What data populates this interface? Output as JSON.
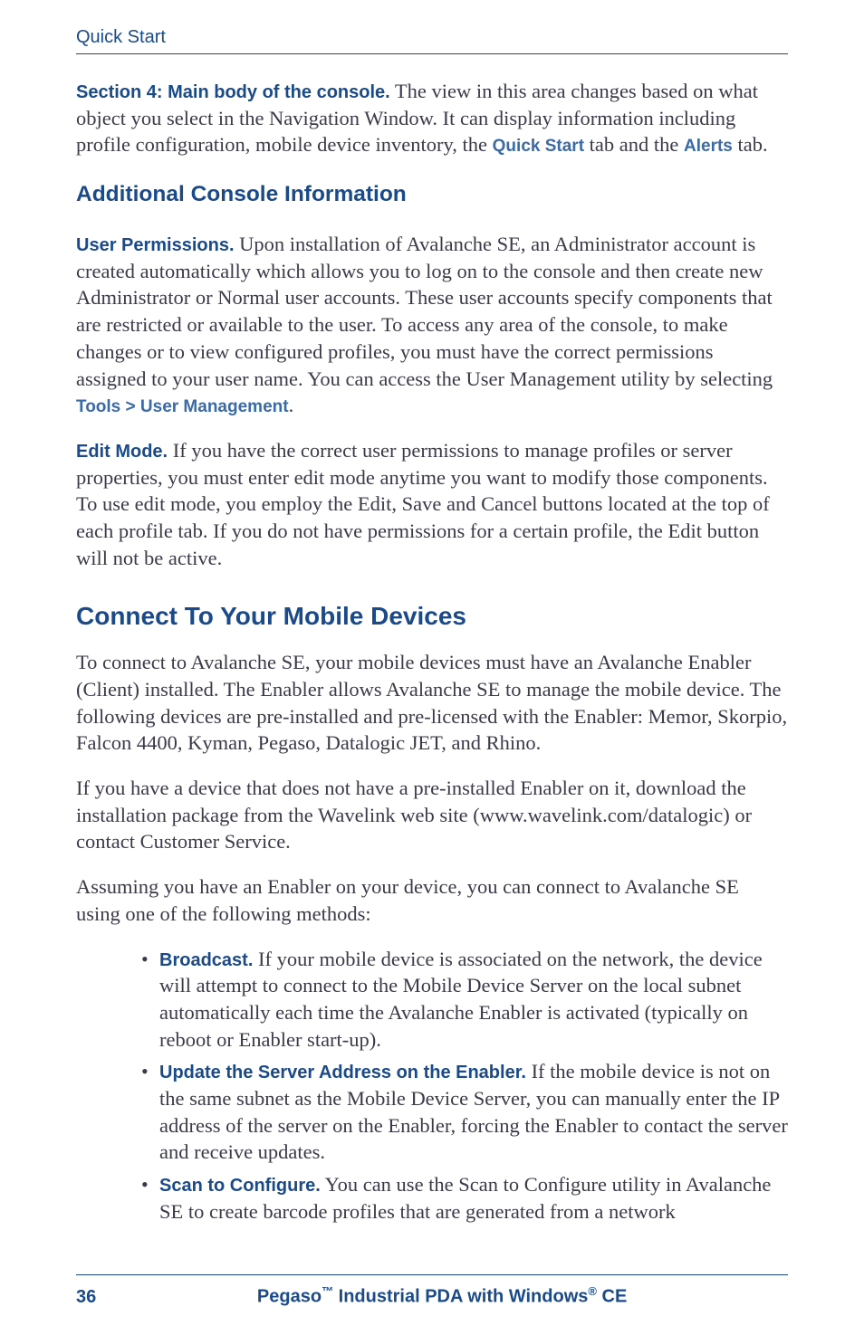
{
  "running_header": "Quick Start",
  "section4": {
    "lead": "Section 4: Main body of the console.",
    "body_a": " The view in this area changes based on what object you select in the Navigation Window. It can display information including profile configuration, mobile device inventory, the ",
    "ui_quickstart": "Quick Start",
    "body_b": " tab and the ",
    "ui_alerts": "Alerts",
    "body_c": " tab."
  },
  "h2": "Additional Console Information",
  "user_perm": {
    "lead": "User Permissions.",
    "body_a": "   Upon installation of Avalanche SE, an Administrator account is created automatically which allows you to log on to the console and then create new Administrator or Normal user accounts. These user accounts specify components that are restricted or available to the user. To access any area of the console, to make changes or to view configured profiles, you must have the correct permissions assigned to your user name. You can access the User Management utility by selecting ",
    "ui_tools": "Tools > User Management",
    "body_b": "."
  },
  "edit_mode": {
    "lead": "Edit Mode.",
    "body": "   If you have the correct user permissions to manage profiles or server properties, you must enter edit mode anytime you want to modify those components. To use edit mode, you employ the Edit, Save and Cancel buttons located at the top of each profile tab. If you do not have permissions for a certain profile, the Edit button will not be active."
  },
  "h1": "Connect To Your Mobile Devices",
  "connect_para": "To connect to Avalanche SE, your mobile devices must have an Avalanche Enabler (Client) installed. The Enabler allows Avalanche SE to manage the mobile device. The following devices are pre-installed and pre-licensed with the Enabler: Memor, Skorpio, Falcon 4400, Kyman, Pegaso, Datalogic JET, and Rhino.",
  "enabler_para": "If you have a device that does not have a pre-installed Enabler on it, download the installation package from the Wavelink web site (www.wavelink.com/datalogic) or contact Customer Service.",
  "assume_para": "Assuming you have an Enabler on your device, you can connect to Avalanche SE using one of the following methods:",
  "bullets": [
    {
      "lead": "Broadcast.",
      "body": " If your mobile device is associated on the network, the device will attempt to connect to the Mobile Device Server on the local subnet automatically each time the Avalanche Enabler is activated (typically on reboot or Enabler start-up)."
    },
    {
      "lead": "Update the Server Address on the Enabler.",
      "body": " If the mobile device is not on the same subnet as the Mobile Device Server, you can manually enter the IP address of the server on the Enabler, forcing the Enabler to contact the server and receive updates."
    },
    {
      "lead": "Scan to Configure.",
      "body": " You can use the Scan to Configure utility in Avalanche SE to create barcode profiles that are generated from a network"
    }
  ],
  "footer": {
    "page": "36",
    "book_a": "Pegaso",
    "tm": "™",
    "book_b": " Industrial PDA with Windows",
    "reg": "®",
    "book_c": " CE"
  }
}
